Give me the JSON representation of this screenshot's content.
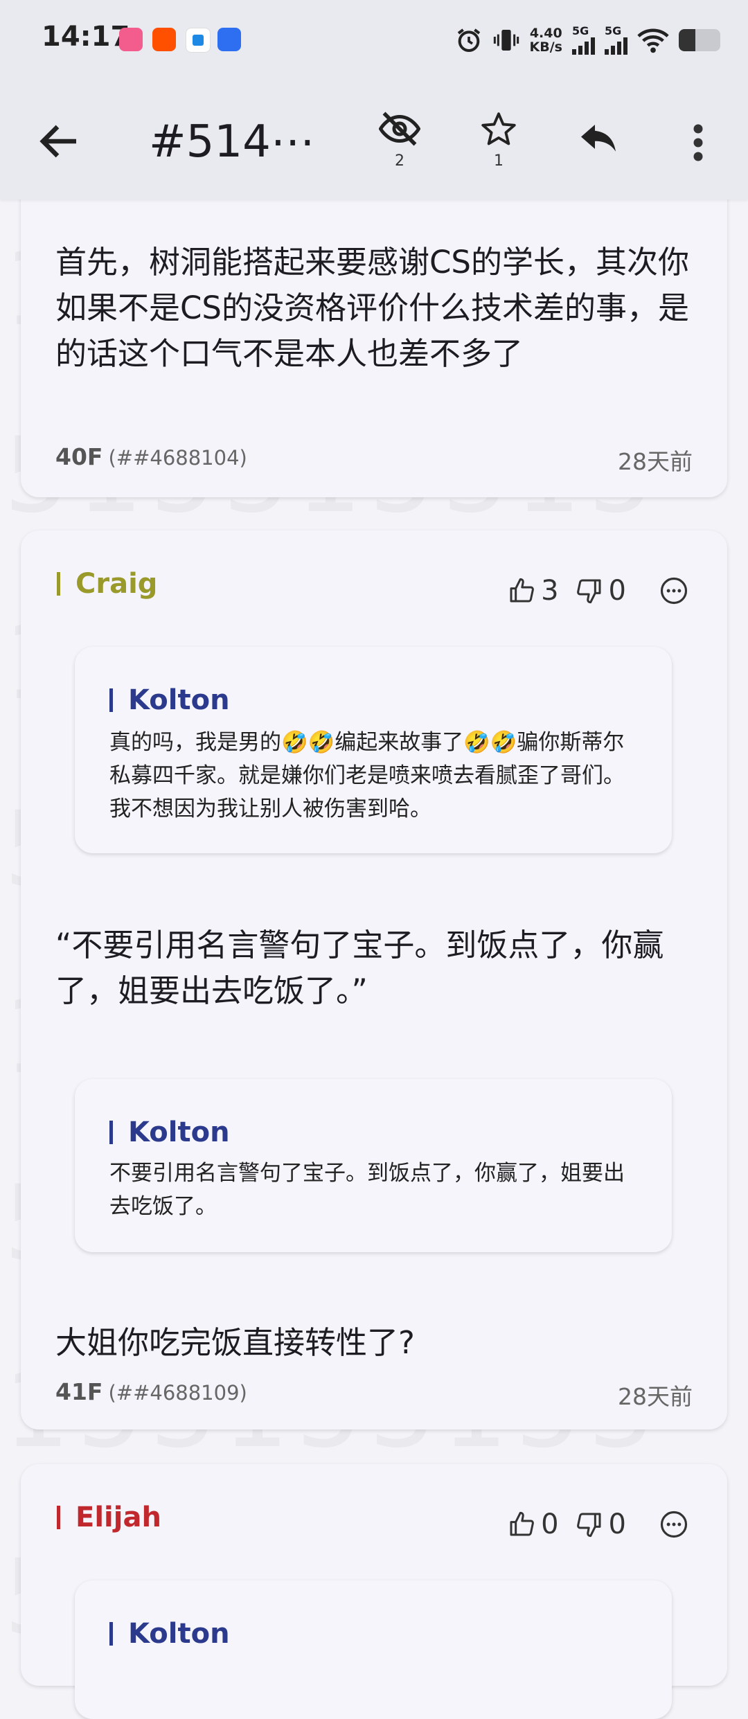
{
  "status_bar": {
    "time": "14:17",
    "net_speed_value": "4.40",
    "net_speed_unit": "KB/s",
    "sim1_label": "5G",
    "sim2_label": "5G"
  },
  "header": {
    "title": "#514⋯",
    "hidden_count": "2",
    "star_count": "1"
  },
  "posts": [
    {
      "text": "首先，树洞能搭起来要感谢CS的学长，其次你如果不是CS的没资格评价什么技术差的事，是的话这个口气不是本人也差不多了",
      "floor": "40F",
      "post_id": "(##4688104)",
      "time": "28天前"
    },
    {
      "author": "Craig",
      "author_color": "#9a9a2a",
      "likes": "3",
      "dislikes": "0",
      "quote1_author": "Kolton",
      "quote1_text": "真的吗，我是男的🤣🤣编起来故事了🤣🤣骗你斯蒂尔私募四千家。就是嫌你们老是喷来喷去看腻歪了哥们。我不想因为我让别人被伤害到哈。",
      "text1": "“不要引用名言警句了宝子。到饭点了，你赢了，姐要出去吃饭了。”",
      "quote2_author": "Kolton",
      "quote2_text": "不要引用名言警句了宝子。到饭点了，你赢了，姐要出去吃饭了。",
      "text2": "大姐你吃完饭直接转性了?",
      "floor": "41F",
      "post_id": "(##4688109)",
      "time": "28天前"
    },
    {
      "author": "Elijah",
      "author_color": "#c0282d",
      "likes": "0",
      "dislikes": "0",
      "quote1_author": "Kolton"
    }
  ]
}
